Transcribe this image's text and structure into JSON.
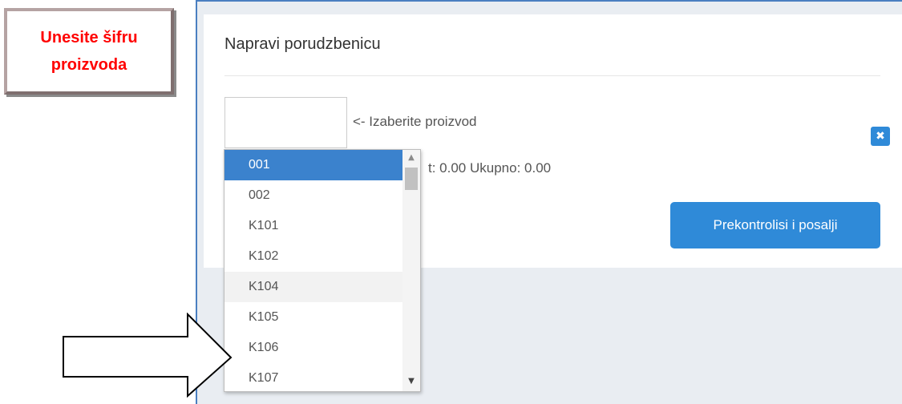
{
  "callout": {
    "text": "Unesite šifru proizvoda",
    "color": "#ff0000"
  },
  "panel": {
    "title": "Napravi porudzbenicu",
    "code_input_value": "",
    "choose_label": "<- Izaberite proizvod",
    "totals_text": "t: 0.00 Ukupno: 0.00",
    "remove_icon": "close-icon",
    "submit_label": "Prekontrolisi i posalji"
  },
  "dropdown": {
    "options": [
      "001",
      "002",
      "K101",
      "K102",
      "K104",
      "K105",
      "K106",
      "K107"
    ],
    "selected": "001",
    "hovered": "K104"
  },
  "colors": {
    "accent": "#2f8ad8",
    "selected_option": "#3b82cd",
    "frame_border": "#4a7fc1"
  },
  "pointer_icon": "right-arrow-outline-icon"
}
